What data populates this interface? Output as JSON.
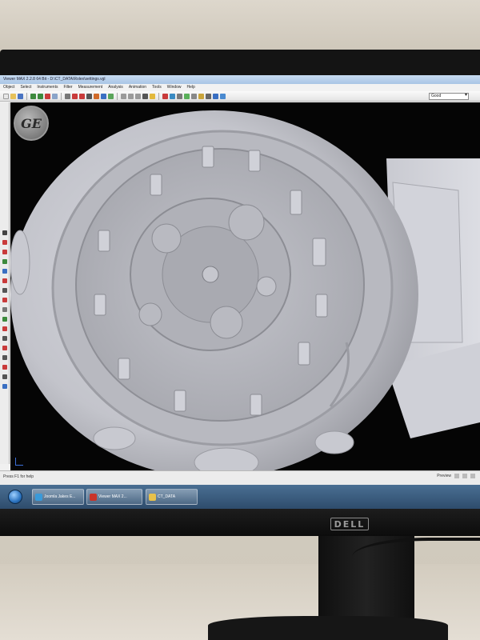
{
  "window": {
    "title": "Viewer MAX 2.2.8 64 Bit - D:\\CT_DATA\\Rolex\\settings.vgl"
  },
  "menu": {
    "items": [
      "Object",
      "Select",
      "Instruments",
      "Filter",
      "Measurement",
      "Analysis",
      "Animation",
      "Tools",
      "Window",
      "Help"
    ]
  },
  "toolbar": {
    "quality_value": "Good"
  },
  "viewport": {
    "logo_text": "GE",
    "object": "ct-rendered-wristwatch"
  },
  "status": {
    "left_text": "Press F1 for help",
    "right_text": "Preview"
  },
  "taskbar": {
    "items": [
      {
        "label": "Joomla Jakes E...",
        "icon_color": "#3a9ad9"
      },
      {
        "label": "Viewer MAX 2...",
        "icon_color": "#c9342a"
      },
      {
        "label": "CT_DATA",
        "icon_color": "#e8c14a"
      }
    ]
  },
  "monitor": {
    "brand": "DELL"
  },
  "colors": {
    "viewport_bg": "#050505",
    "taskbar": "#3c5e82",
    "titlebar": "#b8d0ec"
  }
}
